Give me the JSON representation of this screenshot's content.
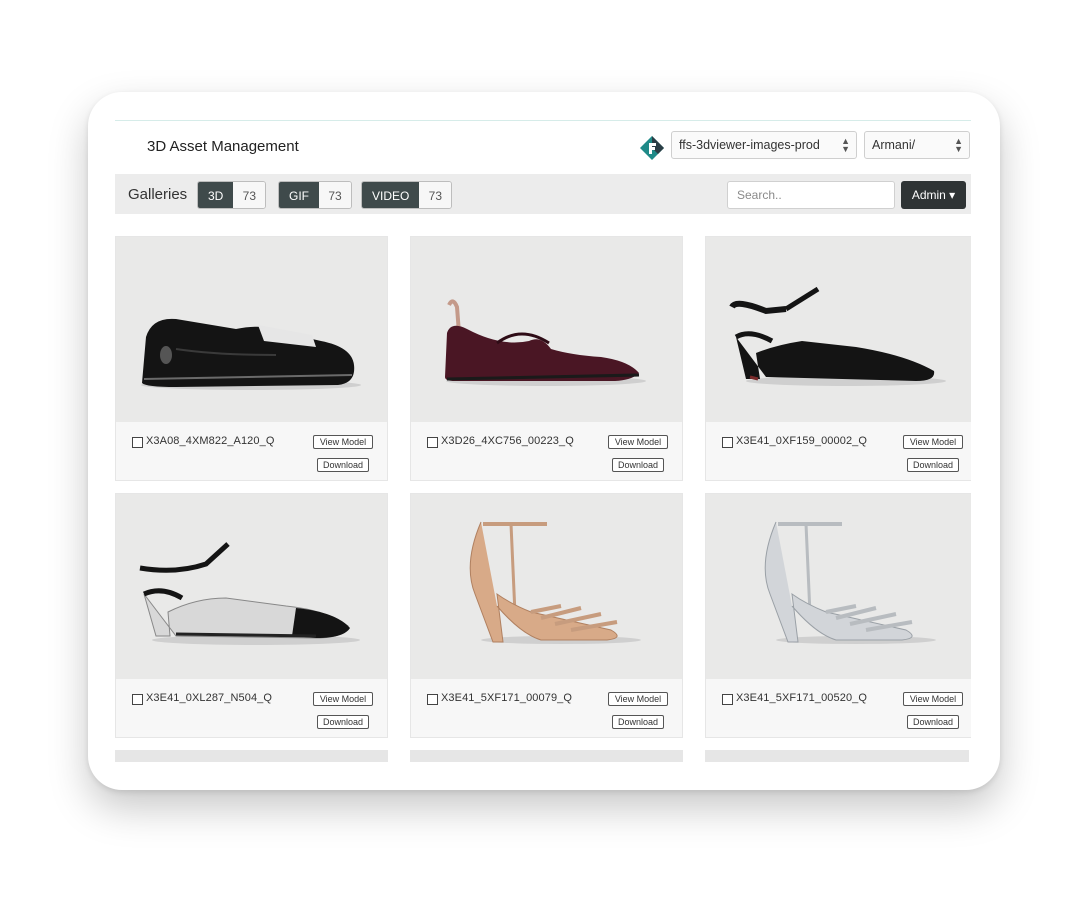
{
  "app": {
    "title": "3D Asset Management"
  },
  "header": {
    "bucket_select": "ffs-3dviewer-images-prod",
    "brand_select": "Armani/"
  },
  "toolbar": {
    "galleries_label": "Galleries",
    "tabs": [
      {
        "label": "3D",
        "count": "73"
      },
      {
        "label": "GIF",
        "count": "73"
      },
      {
        "label": "VIDEO",
        "count": "73"
      }
    ],
    "search_placeholder": "Search..",
    "admin_label": "Admin ▾"
  },
  "cards": [
    {
      "code": "X3A08_4XM822_A120_Q",
      "view_label": "View Model",
      "download_label": "Download"
    },
    {
      "code": "X3D26_4XC756_00223_Q",
      "view_label": "View Model",
      "download_label": "Download"
    },
    {
      "code": "X3E41_0XF159_00002_Q",
      "view_label": "View Model",
      "download_label": "Download"
    },
    {
      "code": "X3E41_0XL287_N504_Q",
      "view_label": "View Model",
      "download_label": "Download"
    },
    {
      "code": "X3E41_5XF171_00079_Q",
      "view_label": "View Model",
      "download_label": "Download"
    },
    {
      "code": "X3E41_5XF171_00520_Q",
      "view_label": "View Model",
      "download_label": "Download"
    }
  ],
  "colors": {
    "accent_dark": "#3f4a4b",
    "logo_teal": "#1f8a88",
    "logo_dark": "#2b3d45"
  }
}
